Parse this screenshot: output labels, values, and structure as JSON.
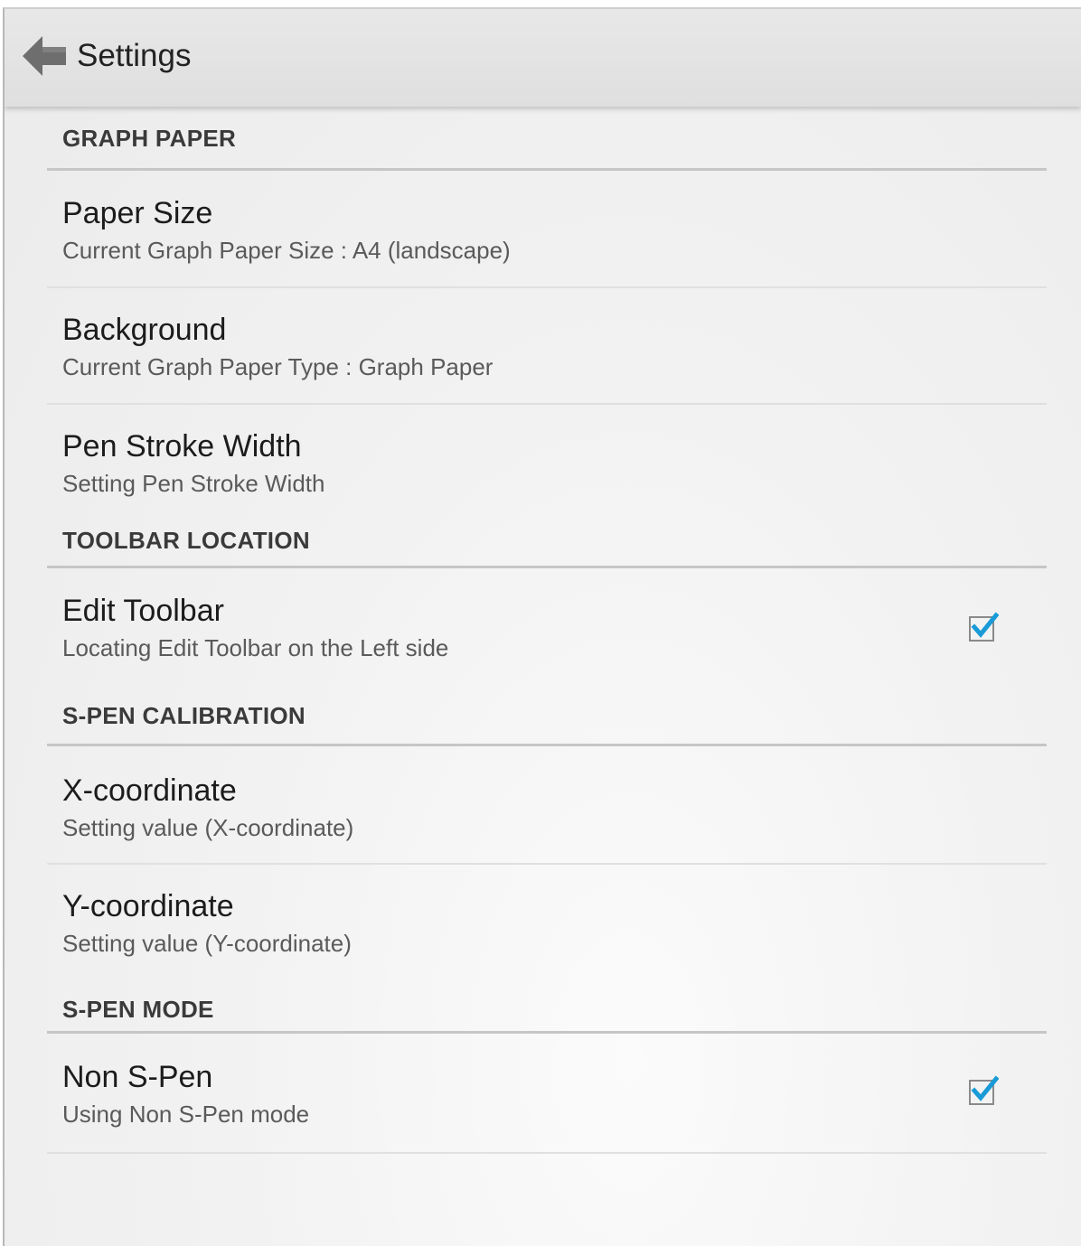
{
  "header": {
    "title": "Settings",
    "back_icon": "back-arrow-icon"
  },
  "sections": {
    "graph_paper": {
      "label": "GRAPH PAPER",
      "items": {
        "paper_size": {
          "title": "Paper Size",
          "summary": "Current Graph Paper Size : A4 (landscape)"
        },
        "background": {
          "title": "Background",
          "summary": "Current Graph Paper Type : Graph Paper"
        },
        "pen_stroke_width": {
          "title": "Pen Stroke Width",
          "summary": "Setting Pen Stroke Width"
        }
      }
    },
    "toolbar_location": {
      "label": "TOOLBAR LOCATION",
      "items": {
        "edit_toolbar": {
          "title": "Edit Toolbar",
          "summary": "Locating Edit Toolbar on the Left side",
          "checked": true
        }
      }
    },
    "spen_calibration": {
      "label": "S-PEN CALIBRATION",
      "items": {
        "x_coordinate": {
          "title": "X-coordinate",
          "summary": "Setting value (X-coordinate)"
        },
        "y_coordinate": {
          "title": "Y-coordinate",
          "summary": "Setting value (Y-coordinate)"
        }
      }
    },
    "spen_mode": {
      "label": "S-PEN MODE",
      "items": {
        "non_spen": {
          "title": "Non S-Pen",
          "summary": "Using Non S-Pen mode",
          "checked": true
        }
      }
    }
  },
  "colors": {
    "accent": "#1a9bd7",
    "checkbox_border": "#8a8a8a"
  }
}
